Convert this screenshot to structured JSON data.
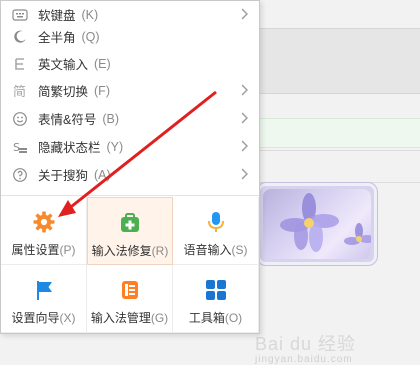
{
  "menu": {
    "items": [
      {
        "icon": "keyboard-icon",
        "label": "软键盘",
        "key": "(K)",
        "has_submenu": true
      },
      {
        "icon": "moon-icon",
        "label": "全半角",
        "key": "(Q)",
        "has_submenu": false
      },
      {
        "icon": "english-icon",
        "label": "英文输入",
        "key": "(E)",
        "has_submenu": false
      },
      {
        "icon": "traditional-icon",
        "label": "简繁切换",
        "key": "(F)",
        "has_submenu": true
      },
      {
        "icon": "smile-icon",
        "label": "表情&符号",
        "key": "(B)",
        "has_submenu": true
      },
      {
        "icon": "statusbar-icon",
        "label": "隐藏状态栏",
        "key": "(Y)",
        "has_submenu": true
      },
      {
        "icon": "help-icon",
        "label": "关于搜狗",
        "key": "(A)",
        "has_submenu": true
      }
    ],
    "tiles": [
      {
        "name": "properties-settings",
        "icon": "gear-icon",
        "label": "属性设置",
        "key": "(P)"
      },
      {
        "name": "ime-repair",
        "icon": "repair-kit-icon",
        "label": "输入法修复",
        "key": "(R)"
      },
      {
        "name": "voice-input",
        "icon": "microphone-icon",
        "label": "语音输入",
        "key": "(S)"
      },
      {
        "name": "setup-wizard",
        "icon": "flag-icon",
        "label": "设置向导",
        "key": "(X)"
      },
      {
        "name": "ime-manager",
        "icon": "list-icon",
        "label": "输入法管理",
        "key": "(G)"
      },
      {
        "name": "toolbox",
        "icon": "grid-icon",
        "label": "工具箱",
        "key": "(O)"
      }
    ]
  },
  "watermark": {
    "text": "Bai du 经验",
    "sub": "jingyan.baidu.com"
  },
  "colors": {
    "gear": "#f58b2d",
    "repair": "#4caf50",
    "mic": "#2196f3",
    "flag": "#1e88e5",
    "list": "#ff7f24",
    "grid": "#1976d2",
    "arrow": "#e02020"
  }
}
